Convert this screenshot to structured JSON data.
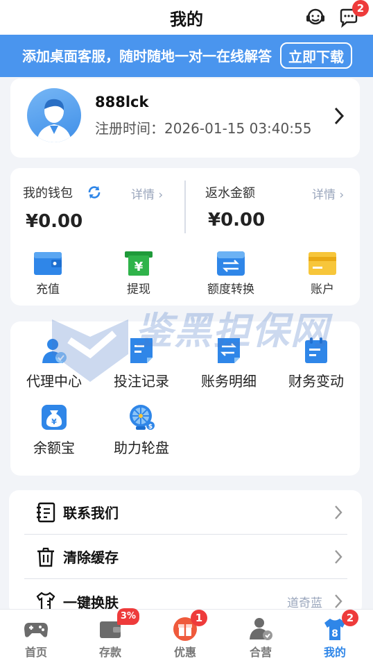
{
  "header": {
    "title": "我的",
    "message_badge": "2"
  },
  "banner": {
    "text": "添加桌面客服，随时随地一对一在线解答",
    "button_label": "立即下载"
  },
  "profile": {
    "username": "888lck",
    "reg_label": "注册时间：",
    "reg_time": "2026-01-15 03:40:55"
  },
  "wallet": {
    "label": "我的钱包",
    "detail": "详情 ›",
    "amount": "¥0.00",
    "rebate_label": "返水金额",
    "rebate_detail": "详情 ›",
    "rebate_amount": "¥0.00",
    "actions": [
      {
        "label": "充值",
        "icon": "wallet-icon"
      },
      {
        "label": "提现",
        "icon": "withdraw-icon"
      },
      {
        "label": "额度转换",
        "icon": "transfer-icon"
      },
      {
        "label": "账户",
        "icon": "card-icon"
      }
    ]
  },
  "services": [
    {
      "label": "代理中心",
      "icon": "agent-icon"
    },
    {
      "label": "投注记录",
      "icon": "bet-record-icon"
    },
    {
      "label": "账务明细",
      "icon": "account-detail-icon"
    },
    {
      "label": "财务变动",
      "icon": "finance-change-icon"
    },
    {
      "label": "余额宝",
      "icon": "money-bag-icon"
    },
    {
      "label": "助力轮盘",
      "icon": "wheel-icon"
    }
  ],
  "menu": [
    {
      "label": "联系我们",
      "value": ""
    },
    {
      "label": "清除缓存",
      "value": ""
    },
    {
      "label": "一键换肤",
      "value": "道奇蓝"
    }
  ],
  "watermark": {
    "text": "鉴黑担保网"
  },
  "nav": [
    {
      "label": "首页",
      "badge": ""
    },
    {
      "label": "存款",
      "badge": "3%"
    },
    {
      "label": "优惠",
      "badge": "1"
    },
    {
      "label": "合营",
      "badge": ""
    },
    {
      "label": "我的",
      "badge": "2"
    }
  ],
  "colors": {
    "accent": "#2f86e8",
    "banner": "#4a95ee",
    "badge": "#ee3b3b"
  }
}
